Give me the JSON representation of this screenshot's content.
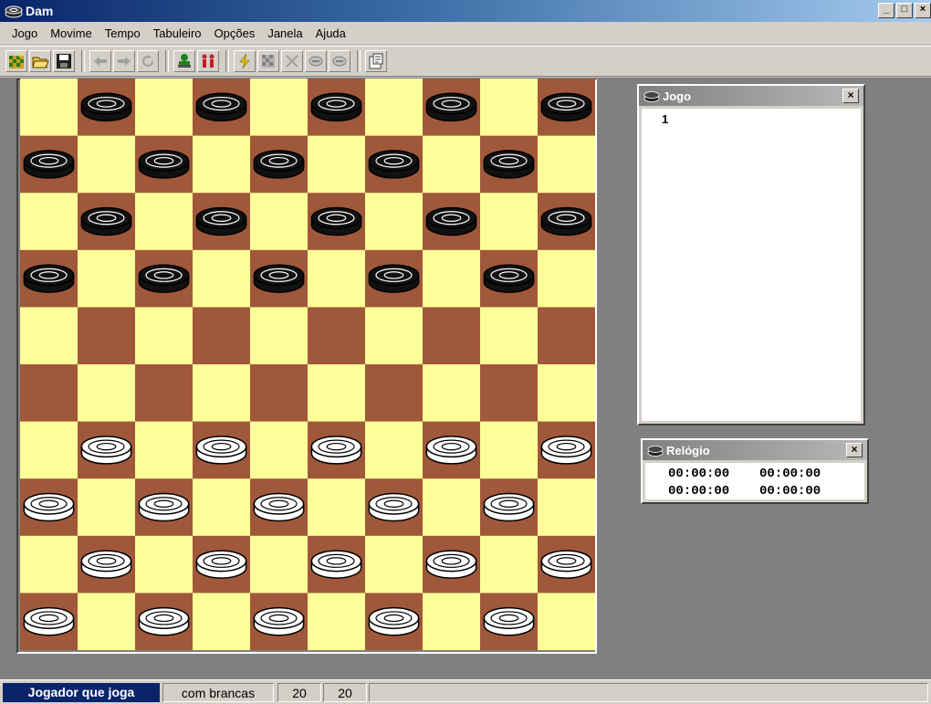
{
  "window": {
    "title": "Dam",
    "minimize": "_",
    "maximize": "□",
    "close": "×"
  },
  "menu": [
    "Jogo",
    "Movime",
    "Tempo",
    "Tabuleiro",
    "Opções",
    "Janela",
    "Ajuda"
  ],
  "toolbar": {
    "buttons": [
      "new-game-icon",
      "open-file-icon",
      "save-icon",
      "undo-arrow-icon",
      "redo-arrow-icon",
      "rotate-icon",
      "player-green-icon",
      "players-red-icon",
      "lightning-icon",
      "board-grid-icon",
      "cancel-x-icon",
      "disc-one-icon",
      "disc-two-icon",
      "properties-icon"
    ]
  },
  "board": {
    "size": 10,
    "light_color": "#ffff99",
    "dark_color": "#a0583a",
    "black_piece_color": "#111111",
    "white_piece_color": "#ffffff",
    "pieces": [
      "-b-b-b-b-b",
      "b-b-b-b-b-",
      "-b-b-b-b-b",
      "b-b-b-b-b-",
      "----------",
      "----------",
      "-w-w-w-w-w",
      "w-w-w-w-w-",
      "-w-w-w-w-w",
      "w-w-w-w-w-"
    ]
  },
  "game_panel": {
    "title": "Jogo",
    "close": "×",
    "moves": [
      "1"
    ]
  },
  "clock_panel": {
    "title": "Relógio",
    "close": "×",
    "times": [
      "00:00:00",
      "00:00:00",
      "00:00:00",
      "00:00:00"
    ]
  },
  "status": {
    "player_label": "Jogador que joga",
    "color_text": "com brancas",
    "count_a": "20",
    "count_b": "20"
  }
}
